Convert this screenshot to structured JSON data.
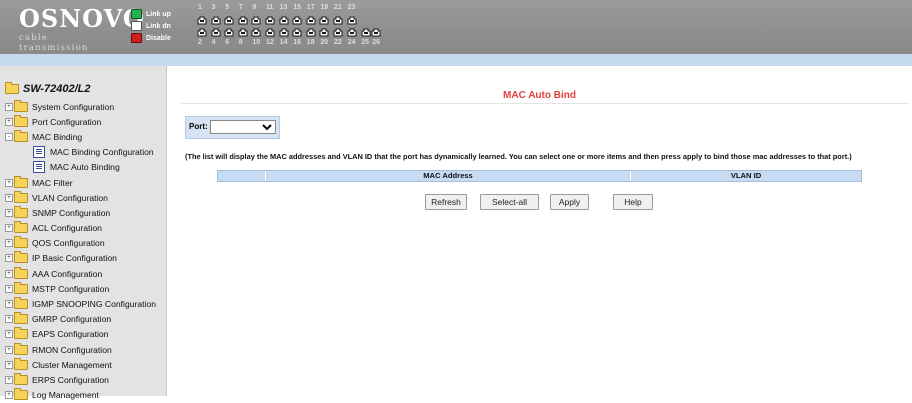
{
  "header": {
    "brand": "OSNOVO",
    "tagline": "cable transmission",
    "legend": [
      {
        "label": "Link up",
        "color": "#22b14c"
      },
      {
        "label": "Link dn",
        "color": "#ffffff"
      },
      {
        "label": "Disable",
        "color": "#d11e1e"
      }
    ],
    "odd_ports": [
      "1",
      "3",
      "5",
      "7",
      "9",
      "11",
      "13",
      "15",
      "17",
      "19",
      "21",
      "23"
    ],
    "even_ports": [
      "2",
      "4",
      "6",
      "8",
      "10",
      "12",
      "14",
      "16",
      "18",
      "20",
      "22",
      "24",
      "25",
      "26"
    ]
  },
  "sidebar": {
    "device": "SW-72402/L2",
    "items": [
      {
        "label": "System Configuration"
      },
      {
        "label": "Port Configuration"
      },
      {
        "label": "MAC Binding"
      },
      {
        "label": "MAC Binding Configuration"
      },
      {
        "label": "MAC Auto Binding"
      },
      {
        "label": "MAC Filter"
      },
      {
        "label": "VLAN Configuration"
      },
      {
        "label": "SNMP Configuration"
      },
      {
        "label": "ACL Configuration"
      },
      {
        "label": "QOS Configuration"
      },
      {
        "label": "IP Basic Configuration"
      },
      {
        "label": "AAA Configuration"
      },
      {
        "label": "MSTP Configuration"
      },
      {
        "label": "IGMP SNOOPING Configuration"
      },
      {
        "label": "GMRP Configuration"
      },
      {
        "label": "EAPS Configuration"
      },
      {
        "label": "RMON Configuration"
      },
      {
        "label": "Cluster Management"
      },
      {
        "label": "ERPS Configuration"
      },
      {
        "label": "Log Management"
      }
    ]
  },
  "main": {
    "title": "MAC Auto Bind",
    "port_label": "Port:",
    "port_value": "",
    "info": "(The list will display the MAC addresses and VLAN ID that the port has dynamically learned. You can select one or more items and then press apply to bind those mac addresses to that port.)",
    "columns": [
      "",
      "MAC Address",
      "VLAN ID"
    ],
    "buttons": {
      "refresh": "Refresh",
      "select_all": "Select-all",
      "apply": "Apply",
      "help": "Help"
    }
  }
}
